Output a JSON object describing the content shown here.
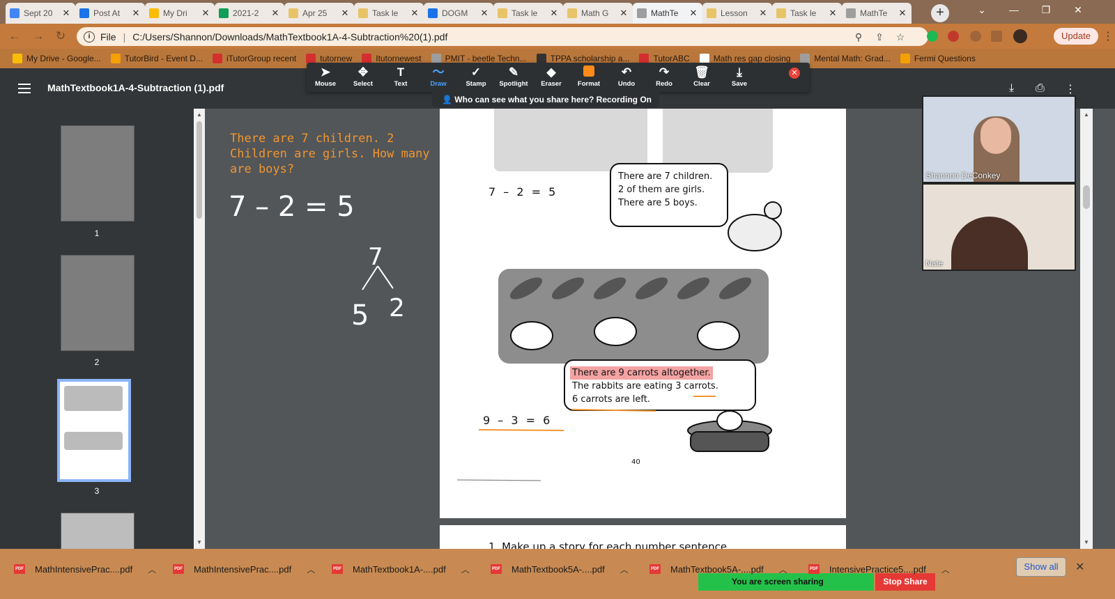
{
  "tabs": [
    {
      "label": "Sept 20",
      "color": "#4285f4"
    },
    {
      "label": "Post At",
      "color": "#1a73e8"
    },
    {
      "label": "My Dri",
      "color": "#fbbc04"
    },
    {
      "label": "2021-2",
      "color": "#0f9d58"
    },
    {
      "label": "Apr 25",
      "color": "#e8c468"
    },
    {
      "label": "Task le",
      "color": "#e8c468"
    },
    {
      "label": "DOGM",
      "color": "#1a73e8"
    },
    {
      "label": "Task le",
      "color": "#e8c468"
    },
    {
      "label": "Math G",
      "color": "#e8c468"
    },
    {
      "label": "MathTe",
      "color": "#9e9e9e",
      "active": true
    },
    {
      "label": "Lesson",
      "color": "#e8c468"
    },
    {
      "label": "Task le",
      "color": "#e8c468"
    },
    {
      "label": "MathTe",
      "color": "#9e9e9e"
    }
  ],
  "address": {
    "scheme": "File",
    "url": "C:/Users/Shannon/Downloads/MathTextbook1A-4-Subtraction%20(1).pdf"
  },
  "update_label": "Update",
  "bookmarks": [
    {
      "label": "My Drive - Google...",
      "color": "#fbbc04"
    },
    {
      "label": "TutorBird - Event D...",
      "color": "#f4a000"
    },
    {
      "label": "iTutorGroup recent",
      "color": "#d32f2f"
    },
    {
      "label": "tutornew",
      "color": "#d32f2f"
    },
    {
      "label": "Itutornewest",
      "color": "#d32f2f"
    },
    {
      "label": "PMIT - beetle Techn...",
      "color": "#9e9e9e"
    },
    {
      "label": "TPPA scholarship a...",
      "color": "#333333"
    },
    {
      "label": "TutorABC",
      "color": "#d32f2f"
    },
    {
      "label": "Math res gap closing",
      "color": "#ffffff"
    },
    {
      "label": "Mental Math: Grad...",
      "color": "#9e9e9e"
    },
    {
      "label": "Fermi Questions",
      "color": "#f4a000"
    }
  ],
  "pdf": {
    "title": "MathTextbook1A-4-Subtraction (1).pdf",
    "thumbnails": [
      "1",
      "2",
      "3"
    ],
    "page_number": "40",
    "eq1": "7 – 2 = 5",
    "bubble1": [
      "There are 7 children.",
      "2 of them are girls.",
      "There are 5 boys."
    ],
    "eq2": "9 – 3 = 6",
    "bubble2": [
      "There are 9 carrots altogether.",
      "The rabbits are eating 3 carrots.",
      "6 carrots are left."
    ],
    "next_page_text": "1.   Make up a story for each number sentence."
  },
  "annotation": {
    "tools": [
      {
        "label": "Mouse",
        "icon": "➤"
      },
      {
        "label": "Select",
        "icon": "✥"
      },
      {
        "label": "Text",
        "icon": "T"
      },
      {
        "label": "Draw",
        "icon": "〜",
        "active": true
      },
      {
        "label": "Stamp",
        "icon": "✓"
      },
      {
        "label": "Spotlight",
        "icon": "✎"
      },
      {
        "label": "Eraser",
        "icon": "◆"
      },
      {
        "label": "Format",
        "icon": "■"
      },
      {
        "label": "Undo",
        "icon": "↶"
      },
      {
        "label": "Redo",
        "icon": "↷"
      },
      {
        "label": "Clear",
        "icon": "🗑"
      },
      {
        "label": "Save",
        "icon": "⤓"
      }
    ],
    "recording_text": "Who can see what you share here? Recording On",
    "format_color": "#ff8c1a"
  },
  "handwriting": {
    "text": "There are 7 children.   2 Children are girls.  How many are boys?",
    "equation": "7 – 2 = 5",
    "bond_top": "7",
    "bond_left": "5",
    "bond_right": "2"
  },
  "participants": [
    {
      "name": "Shannon DeConkey"
    },
    {
      "name": "Nate"
    }
  ],
  "downloads": [
    "MathIntensivePrac....pdf",
    "MathIntensivePrac....pdf",
    "MathTextbook1A-....pdf",
    "MathTextbook5A-....pdf",
    "MathTextbook5A-....pdf",
    "IntensivePractice5....pdf"
  ],
  "show_all": "Show all",
  "sharing_text": "You are screen sharing",
  "stop_share": "Stop Share"
}
